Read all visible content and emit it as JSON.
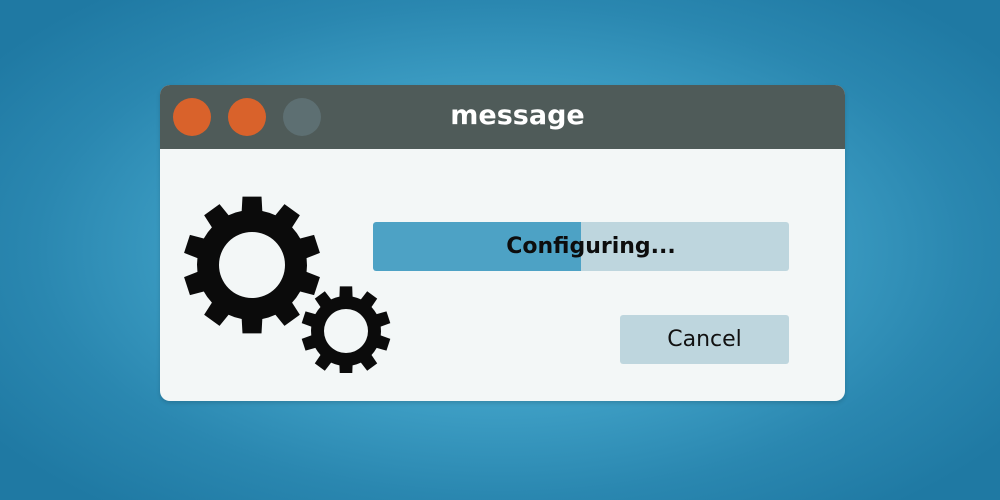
{
  "window": {
    "title": "message",
    "controls": {
      "close_color": "#d9622b",
      "minimize_color": "#d9622b",
      "maximize_color": "#5d6f72"
    }
  },
  "icons": [
    "gear-large-icon",
    "gear-small-icon"
  ],
  "progress": {
    "label": "Configuring...",
    "value": 0.5,
    "fill_color": "#4da2c5",
    "track_color": "#bed6de"
  },
  "actions": {
    "cancel_label": "Cancel"
  }
}
